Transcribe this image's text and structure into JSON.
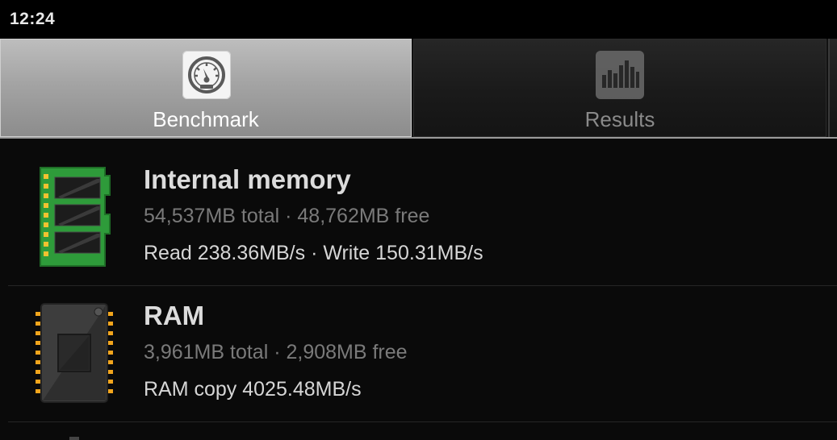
{
  "status_bar": {
    "time": "12:24"
  },
  "tabs": [
    {
      "label": "Benchmark",
      "icon": "speedometer-icon",
      "selected": true
    },
    {
      "label": "Results",
      "icon": "bar-chart-icon",
      "selected": false
    }
  ],
  "items": [
    {
      "title": "Internal memory",
      "icon": "memory-module-icon",
      "summary": "54,537MB total · 48,762MB free",
      "detail": "Read 238.36MB/s · Write 150.31MB/s"
    },
    {
      "title": "RAM",
      "icon": "chip-icon",
      "summary": "3,961MB total · 2,908MB free",
      "detail": "RAM copy 4025.48MB/s"
    }
  ],
  "colors": {
    "memory_board": "#2e9b3a",
    "chip_pins": "#f2a51c"
  }
}
